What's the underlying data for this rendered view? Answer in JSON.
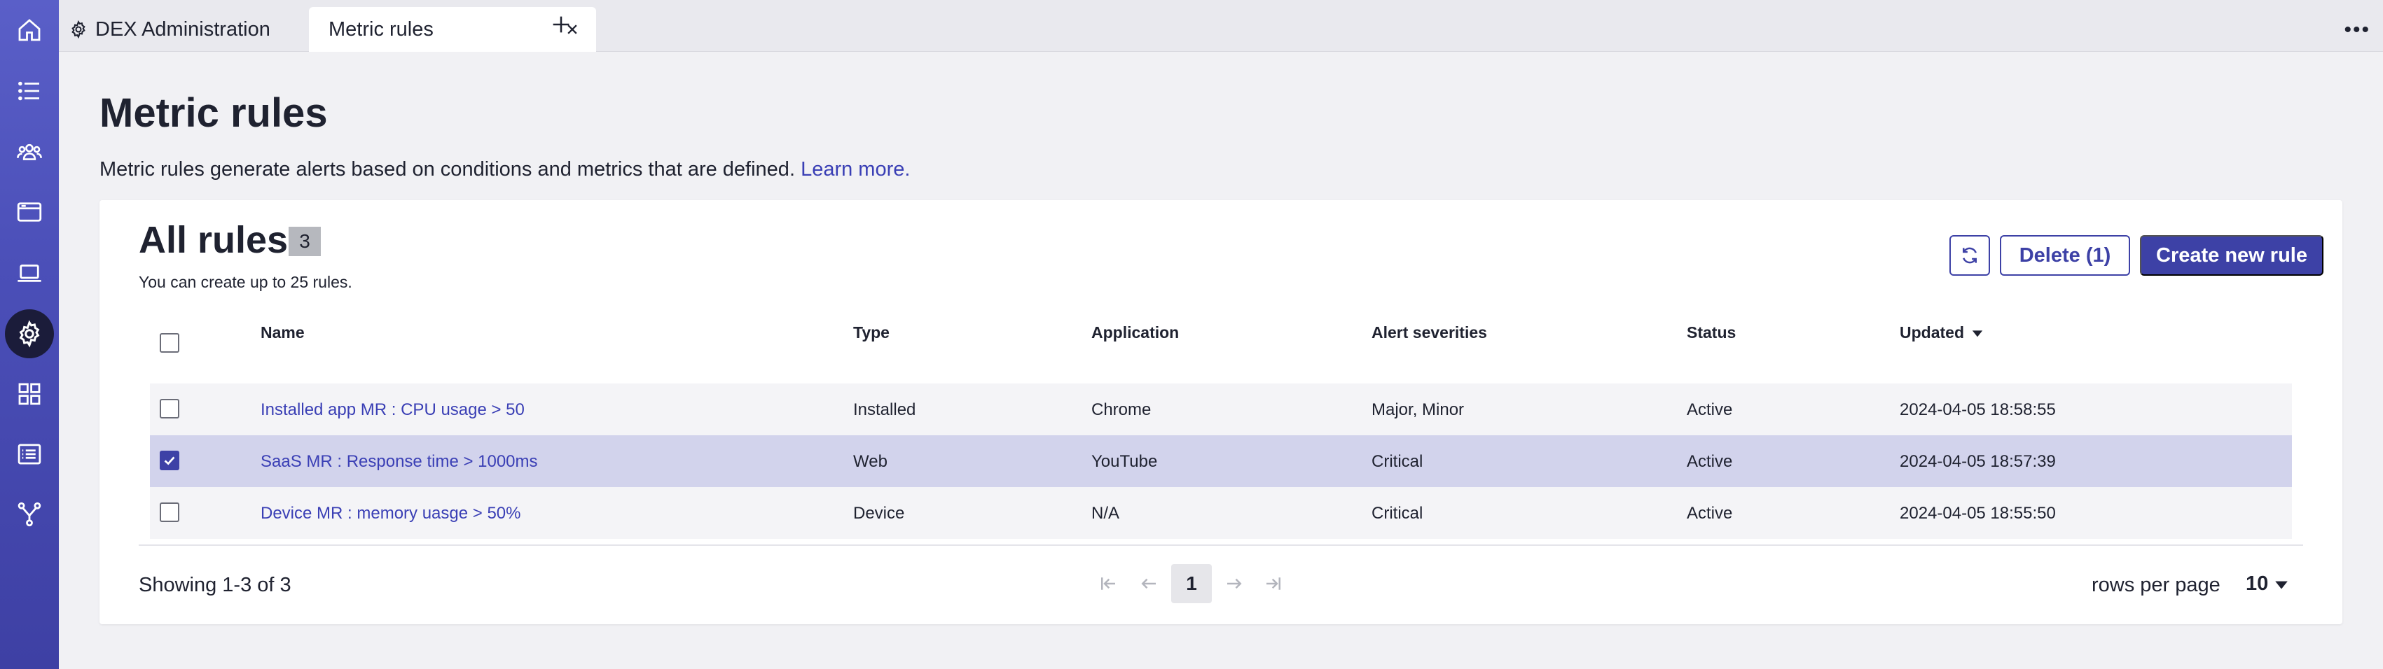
{
  "nav": {
    "items": [
      {
        "icon": "home-icon"
      },
      {
        "icon": "list-icon"
      },
      {
        "icon": "users-icon"
      },
      {
        "icon": "browser-window-icon"
      },
      {
        "icon": "laptop-icon"
      },
      {
        "icon": "gear-icon",
        "active": true
      },
      {
        "icon": "grid-icon"
      },
      {
        "icon": "report-list-icon"
      },
      {
        "icon": "branch-icon"
      }
    ]
  },
  "tabs": {
    "first": "DEX Administration",
    "active": "Metric rules"
  },
  "page": {
    "title": "Metric rules",
    "description": "Metric rules generate alerts based on conditions and metrics that are defined.",
    "learn_more": "Learn more."
  },
  "card": {
    "title": "All rules",
    "count": "3",
    "subtitle": "You can create up to 25 rules.",
    "delete_label": "Delete (1)",
    "create_label": "Create new rule"
  },
  "table": {
    "headers": {
      "name": "Name",
      "type": "Type",
      "application": "Application",
      "severities": "Alert severities",
      "status": "Status",
      "updated": "Updated"
    },
    "rows": [
      {
        "name": "Installed app MR : CPU usage > 50",
        "type": "Installed",
        "application": "Chrome",
        "severities": "Major, Minor",
        "status": "Active",
        "updated": "2024-04-05 18:58:55",
        "selected": false
      },
      {
        "name": "SaaS MR : Response time > 1000ms",
        "type": "Web",
        "application": "YouTube",
        "severities": "Critical",
        "status": "Active",
        "updated": "2024-04-05 18:57:39",
        "selected": true
      },
      {
        "name": "Device MR : memory uasge > 50%",
        "type": "Device",
        "application": "N/A",
        "severities": "Critical",
        "status": "Active",
        "updated": "2024-04-05 18:55:50",
        "selected": false
      }
    ]
  },
  "footer": {
    "showing": "Showing 1-3 of 3",
    "page": "1",
    "rows_per_page_label": "rows per page",
    "rows_per_page_value": "10"
  },
  "colors": {
    "accent": "#3d41a6",
    "selected_row": "#d2d3ec",
    "link": "#3a3fb5"
  }
}
